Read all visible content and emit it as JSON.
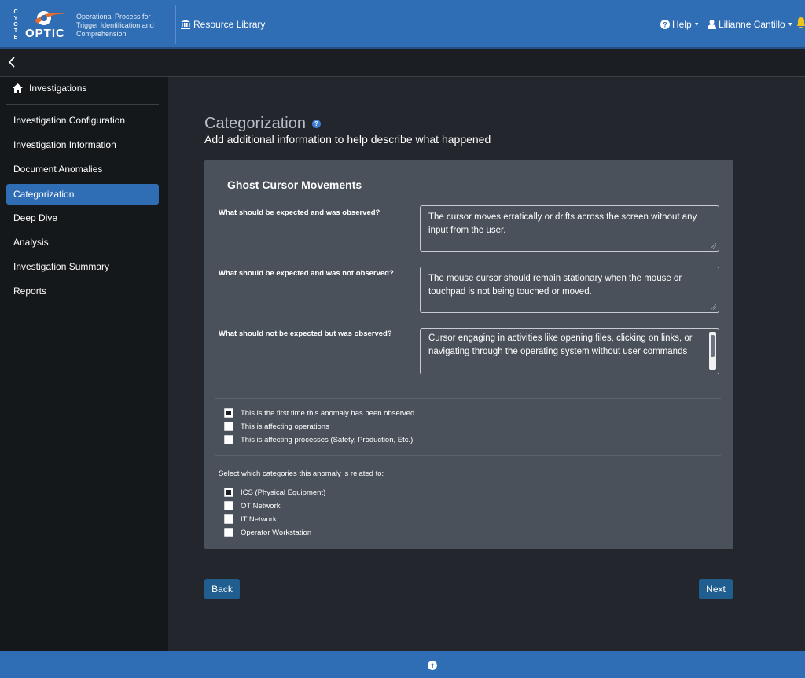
{
  "header": {
    "logo_vertical": "CYOTE",
    "logo_word": "OPTIC",
    "logo_tagline": "Operational Process for Trigger Identification and Comprehension",
    "resource_library": "Resource Library",
    "help": "Help",
    "user": "Lilianne Cantillo"
  },
  "sidebar": {
    "head": "Investigations",
    "items": [
      {
        "label": "Investigation Configuration",
        "active": false
      },
      {
        "label": "Investigation Information",
        "active": false
      },
      {
        "label": "Document Anomalies",
        "active": false
      },
      {
        "label": "Categorization",
        "active": true
      },
      {
        "label": "Deep Dive",
        "active": false
      },
      {
        "label": "Analysis",
        "active": false
      },
      {
        "label": "Investigation Summary",
        "active": false
      },
      {
        "label": "Reports",
        "active": false
      }
    ]
  },
  "main": {
    "title": "Categorization",
    "subtitle": "Add additional information to help describe what happened",
    "card_title": "Ghost Cursor Movements",
    "questions": [
      {
        "label": "What should be expected and was observed?",
        "answer": "The cursor moves erratically or drifts across the screen without any input from the user."
      },
      {
        "label": "What should be expected and was not observed?",
        "answer": "The mouse cursor should remain stationary when the mouse or touchpad is not being touched or moved."
      },
      {
        "label": "What should not be expected but was observed?",
        "answer": "Cursor engaging in activities like opening files, clicking on links, or navigating through the operating system without user commands"
      }
    ],
    "status_checks": [
      {
        "label": "This is the first time this anomaly has been observed",
        "checked": true
      },
      {
        "label": "This is affecting operations",
        "checked": false
      },
      {
        "label": "This is affecting processes (Safety, Production, Etc.)",
        "checked": false
      }
    ],
    "category_prompt": "Select which categories this anomaly is related to:",
    "categories": [
      {
        "label": "ICS (Physical Equipment)",
        "checked": true
      },
      {
        "label": "OT Network",
        "checked": false
      },
      {
        "label": "IT Network",
        "checked": false
      },
      {
        "label": "Operator Workstation",
        "checked": false
      }
    ],
    "back_label": "Back",
    "next_label": "Next"
  },
  "colors": {
    "brand_blue": "#2f6db4",
    "button_blue": "#1f5e8f",
    "card_bg": "#4a515a",
    "sidebar_bg": "#15181b"
  },
  "icons": [
    "bank-icon",
    "help-circle-icon",
    "user-icon",
    "bell-icon",
    "chevron-left-icon",
    "home-icon",
    "question-icon",
    "arrow-up-circle-icon"
  ]
}
